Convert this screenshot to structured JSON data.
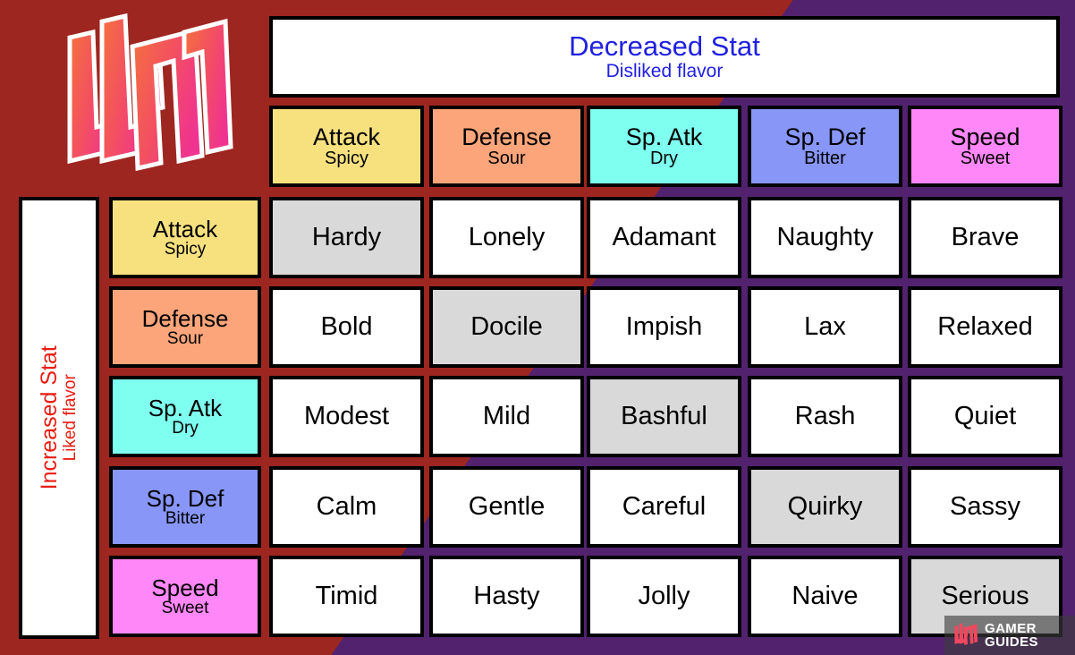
{
  "theme": {
    "background_purple": "#52226E",
    "background_red": "#9E2620",
    "neutral_cell": "#D9D9D9",
    "header_text_blue": "#2020E0",
    "axis_text_red": "#E61E14"
  },
  "column_axis": {
    "title": "Decreased Stat",
    "subtitle": "Disliked flavor",
    "headers": [
      {
        "stat": "Attack",
        "flavor": "Spicy",
        "color": "#F7E17F"
      },
      {
        "stat": "Defense",
        "flavor": "Sour",
        "color": "#FCA57A"
      },
      {
        "stat": "Sp. Atk",
        "flavor": "Dry",
        "color": "#7FFFEF"
      },
      {
        "stat": "Sp. Def",
        "flavor": "Bitter",
        "color": "#8796F7"
      },
      {
        "stat": "Speed",
        "flavor": "Sweet",
        "color": "#FF87F7"
      }
    ]
  },
  "row_axis": {
    "title": "Increased Stat",
    "subtitle": "Liked flavor",
    "headers": [
      {
        "stat": "Attack",
        "flavor": "Spicy",
        "color": "#F7E17F"
      },
      {
        "stat": "Defense",
        "flavor": "Sour",
        "color": "#FCA57A"
      },
      {
        "stat": "Sp. Atk",
        "flavor": "Dry",
        "color": "#7FFFEF"
      },
      {
        "stat": "Sp. Def",
        "flavor": "Bitter",
        "color": "#8796F7"
      },
      {
        "stat": "Speed",
        "flavor": "Sweet",
        "color": "#FF87F7"
      }
    ]
  },
  "natures": [
    [
      {
        "name": "Hardy",
        "neutral": true
      },
      {
        "name": "Lonely",
        "neutral": false
      },
      {
        "name": "Adamant",
        "neutral": false
      },
      {
        "name": "Naughty",
        "neutral": false
      },
      {
        "name": "Brave",
        "neutral": false
      }
    ],
    [
      {
        "name": "Bold",
        "neutral": false
      },
      {
        "name": "Docile",
        "neutral": true
      },
      {
        "name": "Impish",
        "neutral": false
      },
      {
        "name": "Lax",
        "neutral": false
      },
      {
        "name": "Relaxed",
        "neutral": false
      }
    ],
    [
      {
        "name": "Modest",
        "neutral": false
      },
      {
        "name": "Mild",
        "neutral": false
      },
      {
        "name": "Bashful",
        "neutral": true
      },
      {
        "name": "Rash",
        "neutral": false
      },
      {
        "name": "Quiet",
        "neutral": false
      }
    ],
    [
      {
        "name": "Calm",
        "neutral": false
      },
      {
        "name": "Gentle",
        "neutral": false
      },
      {
        "name": "Careful",
        "neutral": false
      },
      {
        "name": "Quirky",
        "neutral": true
      },
      {
        "name": "Sassy",
        "neutral": false
      }
    ],
    [
      {
        "name": "Timid",
        "neutral": false
      },
      {
        "name": "Hasty",
        "neutral": false
      },
      {
        "name": "Jolly",
        "neutral": false
      },
      {
        "name": "Naive",
        "neutral": false
      },
      {
        "name": "Serious",
        "neutral": true
      }
    ]
  ],
  "watermark": {
    "line1": "GAMER",
    "line2": "GUIDES"
  }
}
